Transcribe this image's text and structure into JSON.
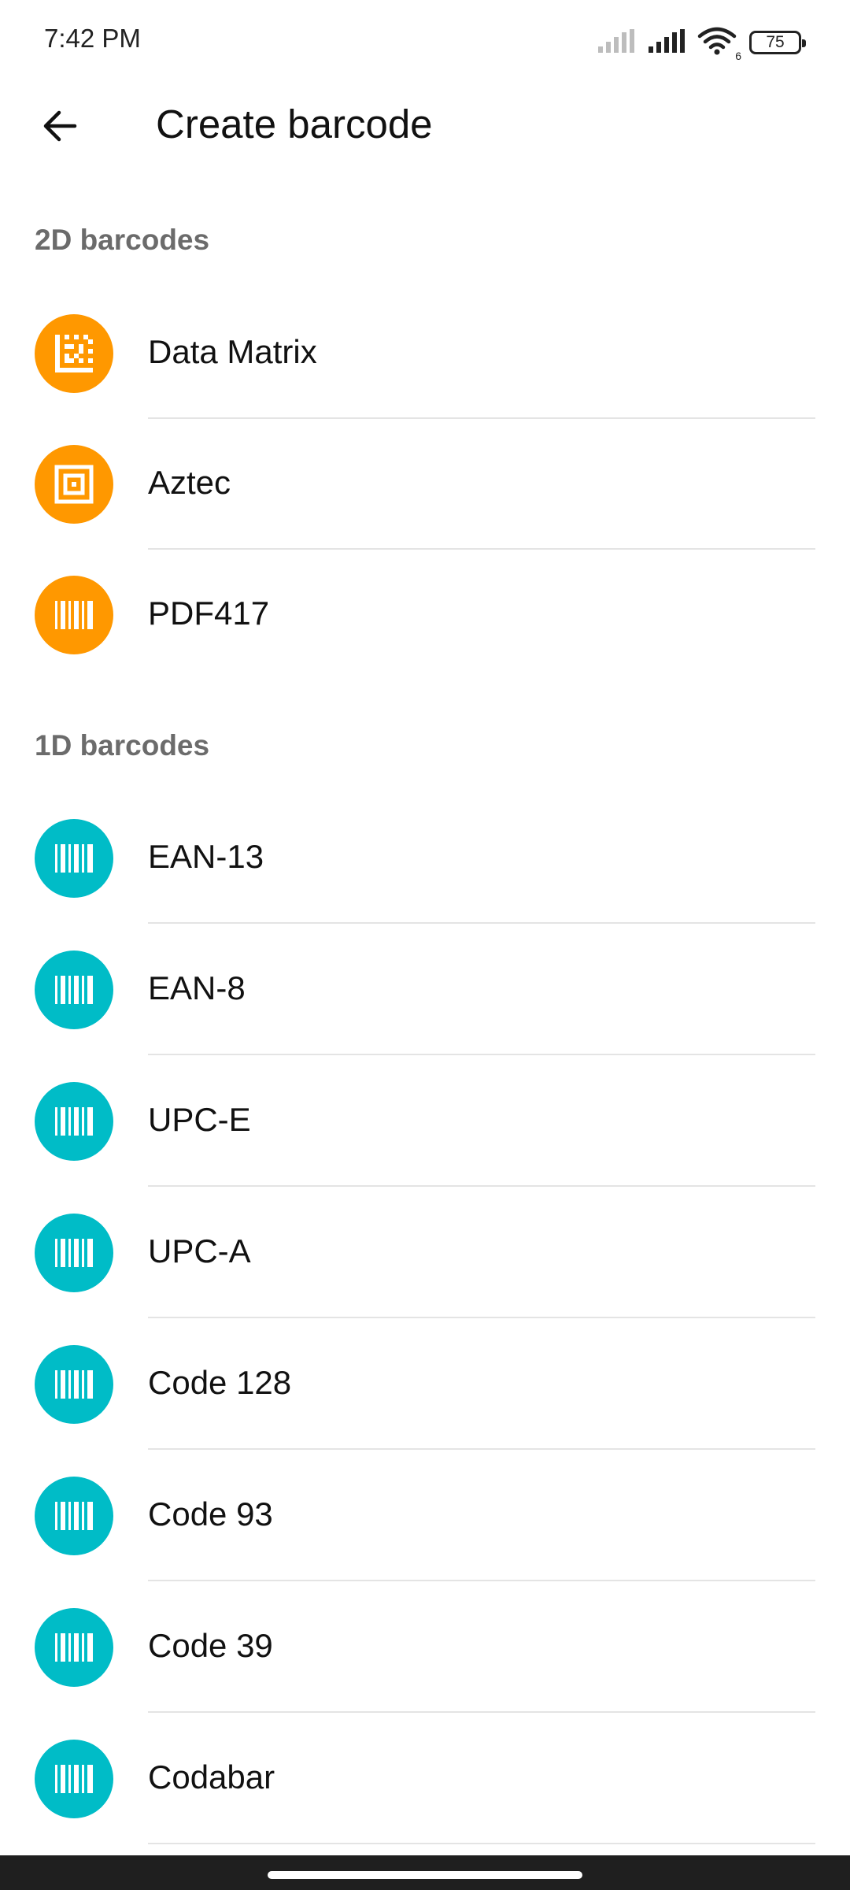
{
  "status_bar": {
    "time": "7:42 PM",
    "battery": "75",
    "wifi_badge": "6"
  },
  "header": {
    "title": "Create barcode"
  },
  "colors": {
    "orange": "#FF9800",
    "teal": "#00BCC7"
  },
  "sections": {
    "two_d": {
      "title": "2D barcodes",
      "items": [
        {
          "label": "Data Matrix",
          "icon": "data-matrix-icon"
        },
        {
          "label": "Aztec",
          "icon": "aztec-icon"
        },
        {
          "label": "PDF417",
          "icon": "barcode-icon"
        }
      ]
    },
    "one_d": {
      "title": "1D barcodes",
      "items": [
        {
          "label": "EAN-13",
          "icon": "barcode-icon"
        },
        {
          "label": "EAN-8",
          "icon": "barcode-icon"
        },
        {
          "label": "UPC-E",
          "icon": "barcode-icon"
        },
        {
          "label": "UPC-A",
          "icon": "barcode-icon"
        },
        {
          "label": "Code 128",
          "icon": "barcode-icon"
        },
        {
          "label": "Code 93",
          "icon": "barcode-icon"
        },
        {
          "label": "Code 39",
          "icon": "barcode-icon"
        },
        {
          "label": "Codabar",
          "icon": "barcode-icon"
        }
      ]
    }
  }
}
